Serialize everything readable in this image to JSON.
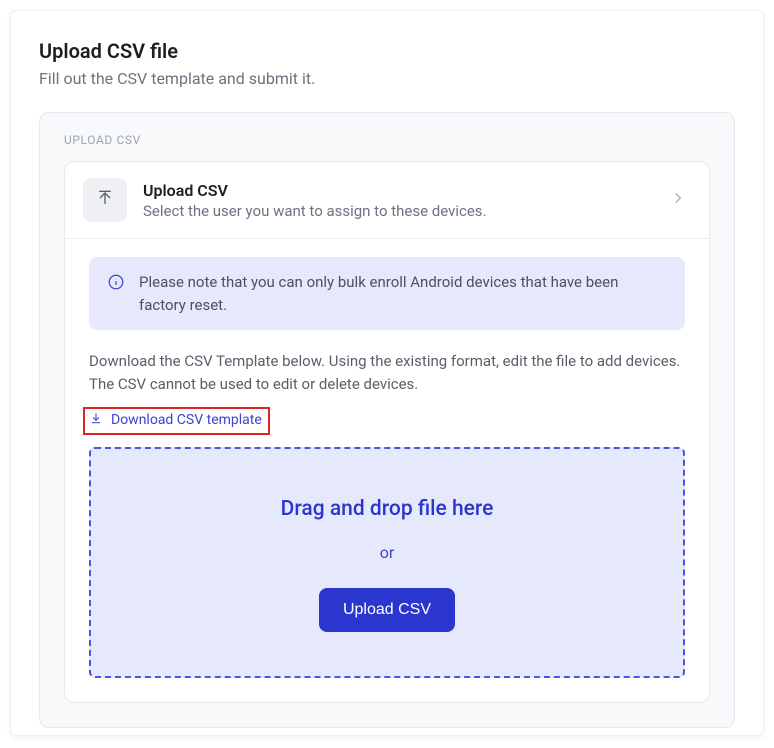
{
  "page": {
    "title": "Upload CSV file",
    "subtitle": "Fill out the CSV template and submit it."
  },
  "outer": {
    "label": "UPLOAD CSV"
  },
  "card": {
    "title": "Upload CSV",
    "desc": "Select the user you want to assign to these devices."
  },
  "notice": {
    "text": "Please note that you can only bulk enroll Android devices that have been factory reset."
  },
  "instructions": "Download the CSV Template below. Using the existing format, edit the file to add devices. The CSV cannot be used to edit or delete devices.",
  "download": {
    "label": "Download CSV template"
  },
  "dropzone": {
    "title": "Drag and drop file here",
    "or": "or",
    "button": "Upload CSV"
  }
}
